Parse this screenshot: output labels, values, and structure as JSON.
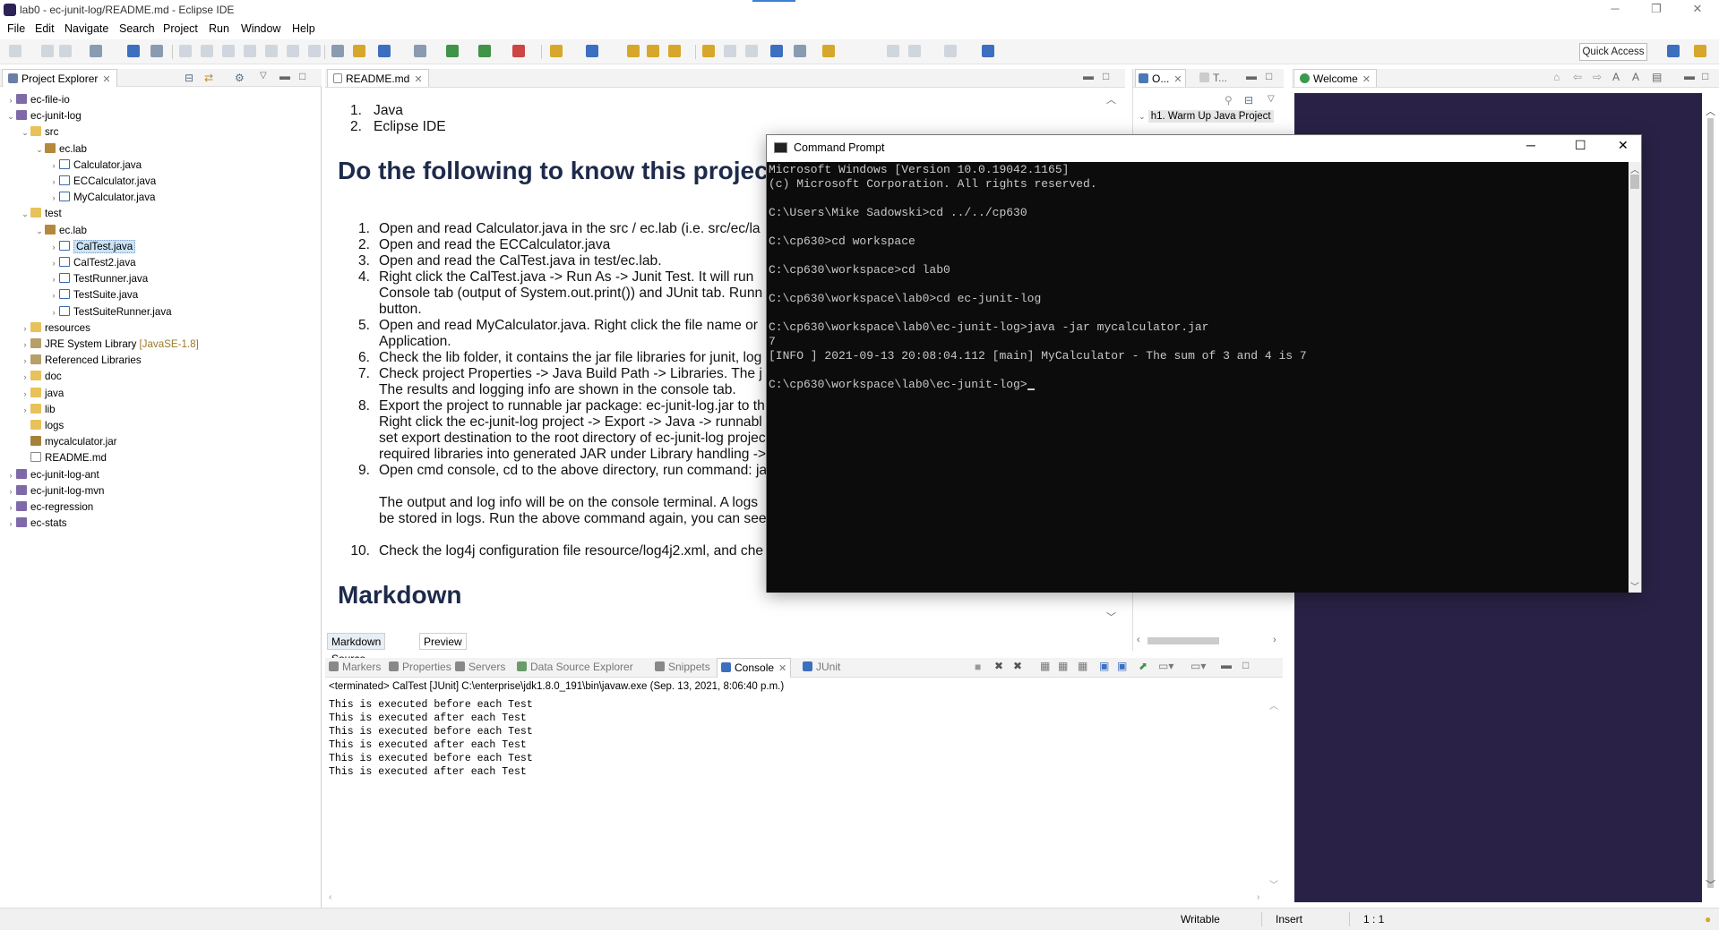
{
  "window": {
    "title": "lab0 - ec-junit-log/README.md - Eclipse IDE"
  },
  "menu": [
    "File",
    "Edit",
    "Navigate",
    "Search",
    "Project",
    "Run",
    "Window",
    "Help"
  ],
  "toolbar": {
    "quick_access": "Quick Access"
  },
  "explorer": {
    "title": "Project Explorer",
    "rows": [
      {
        "label": "ec-file-io",
        "depth": 0,
        "icon": "project-icon",
        "tw": "›"
      },
      {
        "label": "ec-junit-log",
        "depth": 0,
        "icon": "project-icon",
        "tw": "⌄"
      },
      {
        "label": "src",
        "depth": 1,
        "icon": "folder-icon",
        "tw": "⌄"
      },
      {
        "label": "ec.lab",
        "depth": 2,
        "icon": "package-icon",
        "tw": "⌄"
      },
      {
        "label": "Calculator.java",
        "depth": 3,
        "icon": "java-file-icon",
        "tw": "›"
      },
      {
        "label": "ECCalculator.java",
        "depth": 3,
        "icon": "java-file-icon",
        "tw": "›"
      },
      {
        "label": "MyCalculator.java",
        "depth": 3,
        "icon": "java-file-icon",
        "tw": "›"
      },
      {
        "label": "test",
        "depth": 1,
        "icon": "folder-icon",
        "tw": "⌄"
      },
      {
        "label": "ec.lab",
        "depth": 2,
        "icon": "package-icon",
        "tw": "⌄"
      },
      {
        "label": "CalTest.java",
        "depth": 3,
        "icon": "java-file-icon",
        "tw": "›",
        "selected": true
      },
      {
        "label": "CalTest2.java",
        "depth": 3,
        "icon": "java-file-icon",
        "tw": "›"
      },
      {
        "label": "TestRunner.java",
        "depth": 3,
        "icon": "java-file-icon",
        "tw": "›"
      },
      {
        "label": "TestSuite.java",
        "depth": 3,
        "icon": "java-file-icon",
        "tw": "›"
      },
      {
        "label": "TestSuiteRunner.java",
        "depth": 3,
        "icon": "java-file-icon",
        "tw": "›"
      },
      {
        "label": "resources",
        "depth": 1,
        "icon": "folder-icon",
        "tw": "›"
      },
      {
        "label": "JRE System Library",
        "extra": "[JavaSE-1.8]",
        "depth": 1,
        "icon": "library-icon",
        "tw": "›"
      },
      {
        "label": "Referenced Libraries",
        "depth": 1,
        "icon": "library-icon",
        "tw": "›"
      },
      {
        "label": "doc",
        "depth": 1,
        "icon": "folder-icon",
        "tw": "›"
      },
      {
        "label": "java",
        "depth": 1,
        "icon": "folder-icon",
        "tw": "›"
      },
      {
        "label": "lib",
        "depth": 1,
        "icon": "folder-icon",
        "tw": "›"
      },
      {
        "label": "logs",
        "depth": 1,
        "icon": "folder-icon",
        "tw": ""
      },
      {
        "label": "mycalculator.jar",
        "depth": 1,
        "icon": "jar-icon",
        "tw": ""
      },
      {
        "label": "README.md",
        "depth": 1,
        "icon": "markdown-file-icon",
        "tw": ""
      },
      {
        "label": "ec-junit-log-ant",
        "depth": 0,
        "icon": "project-icon",
        "tw": "›"
      },
      {
        "label": "ec-junit-log-mvn",
        "depth": 0,
        "icon": "project-icon",
        "tw": "›"
      },
      {
        "label": "ec-regression",
        "depth": 0,
        "icon": "project-icon",
        "tw": "›"
      },
      {
        "label": "ec-stats",
        "depth": 0,
        "icon": "project-icon",
        "tw": "›"
      }
    ]
  },
  "editor": {
    "tab": "README.md",
    "top_list": [
      {
        "n": "1.",
        "t": "Java"
      },
      {
        "n": "2.",
        "t": "Eclipse IDE"
      }
    ],
    "heading1": "Do the following to know this projec",
    "steps": [
      {
        "n": "1.",
        "t": "Open and read Calculator.java in the src / ec.lab (i.e. src/ec/la"
      },
      {
        "n": "2.",
        "t": "Open and read the ECCalculator.java"
      },
      {
        "n": "3.",
        "t": "Open and read the CalTest.java in test/ec.lab."
      },
      {
        "n": "4.",
        "t": "Right click the CalTest.java -> Run As -> Junit Test. It will run"
      },
      {
        "n": "",
        "t": "Console tab (output of System.out.print()) and JUnit tab. Runn"
      },
      {
        "n": "",
        "t": "button."
      },
      {
        "n": "5.",
        "t": "Open and read MyCalculator.java. Right click the file name or"
      },
      {
        "n": "",
        "t": "Application."
      },
      {
        "n": "6.",
        "t": "Check the lib folder, it contains the jar file libraries for junit, log"
      },
      {
        "n": "7.",
        "t": "Check project Properties -> Java Build Path -> Libraries. The j"
      },
      {
        "n": "",
        "t": "The results and logging info are shown in the console tab."
      },
      {
        "n": "8.",
        "t": "Export the project to runnable jar package: ec-junit-log.jar to th"
      },
      {
        "n": "",
        "t": "Right click the ec-junit-log project -> Export -> Java -> runnabl"
      },
      {
        "n": "",
        "t": "set export destination to the root directory of ec-junit-log projec"
      },
      {
        "n": "",
        "t": "required libraries into generated JAR under Library handling ->"
      },
      {
        "n": "9.",
        "t": "Open cmd console, cd to the above directory, run command: ja"
      },
      {
        "n": "",
        "t": ""
      },
      {
        "n": "",
        "t": "The output and log info will be on the console terminal. A logs"
      },
      {
        "n": "",
        "t": "be stored in logs. Run the above command again, you can see"
      },
      {
        "n": "",
        "t": ""
      },
      {
        "n": "10.",
        "t": "Check the log4j configuration file resource/log4j2.xml, and che"
      }
    ],
    "heading2": "Markdown",
    "bottom_tabs": [
      "Markdown Source",
      "Preview"
    ]
  },
  "outline": {
    "tab1": "O...",
    "tab2": "T...",
    "item": "h1. Warm Up Java Project"
  },
  "welcome": {
    "tab": "Welcome"
  },
  "console": {
    "tabs": [
      "Markers",
      "Properties",
      "Servers",
      "Data Source Explorer",
      "Snippets",
      "Console",
      "JUnit"
    ],
    "header": "<terminated> CalTest [JUnit] C:\\enterprise\\jdk1.8.0_191\\bin\\javaw.exe (Sep. 13, 2021, 8:06:40 p.m.)",
    "lines": [
      "This is executed before each Test",
      "This is executed after each Test",
      "This is executed before each Test",
      "This is executed after each Test",
      "This is executed before each Test",
      "This is executed after each Test"
    ]
  },
  "cmd": {
    "title": "Command Prompt",
    "lines": [
      "Microsoft Windows [Version 10.0.19042.1165]",
      "(c) Microsoft Corporation. All rights reserved.",
      "",
      "C:\\Users\\Mike Sadowski>cd ../../cp630",
      "",
      "C:\\cp630>cd workspace",
      "",
      "C:\\cp630\\workspace>cd lab0",
      "",
      "C:\\cp630\\workspace\\lab0>cd ec-junit-log",
      "",
      "C:\\cp630\\workspace\\lab0\\ec-junit-log>java -jar mycalculator.jar",
      "7",
      "[INFO ] 2021-09-13 20:08:04.112 [main] MyCalculator - The sum of 3 and 4 is 7",
      "",
      "C:\\cp630\\workspace\\lab0\\ec-junit-log>"
    ]
  },
  "status": {
    "writable": "Writable",
    "insert": "Insert",
    "position": "1 : 1"
  }
}
